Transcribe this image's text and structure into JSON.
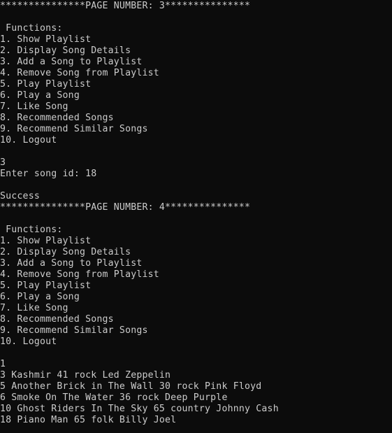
{
  "console": {
    "lines": [
      "***************PAGE NUMBER: 3***************",
      "",
      " Functions:",
      "1. Show Playlist",
      "2. Display Song Details",
      "3. Add a Song to Playlist",
      "4. Remove Song from Playlist",
      "5. Play Playlist",
      "6. Play a Song",
      "7. Like Song",
      "8. Recommended Songs",
      "9. Recommend Similar Songs",
      "10. Logout",
      "",
      "3",
      "Enter song id: 18",
      "",
      "Success",
      "***************PAGE NUMBER: 4***************",
      "",
      " Functions:",
      "1. Show Playlist",
      "2. Display Song Details",
      "3. Add a Song to Playlist",
      "4. Remove Song from Playlist",
      "5. Play Playlist",
      "6. Play a Song",
      "7. Like Song",
      "8. Recommended Songs",
      "9. Recommend Similar Songs",
      "10. Logout",
      "",
      "1",
      "3 Kashmir 41 rock Led Zeppelin",
      "5 Another Brick in The Wall 30 rock Pink Floyd",
      "6 Smoke On The Water 36 rock Deep Purple",
      "10 Ghost Riders In The Sky 65 country Johnny Cash",
      "18 Piano Man 65 folk Billy Joel"
    ]
  },
  "colors": {
    "background": "#0c0c0c",
    "text": "#cccccc"
  }
}
